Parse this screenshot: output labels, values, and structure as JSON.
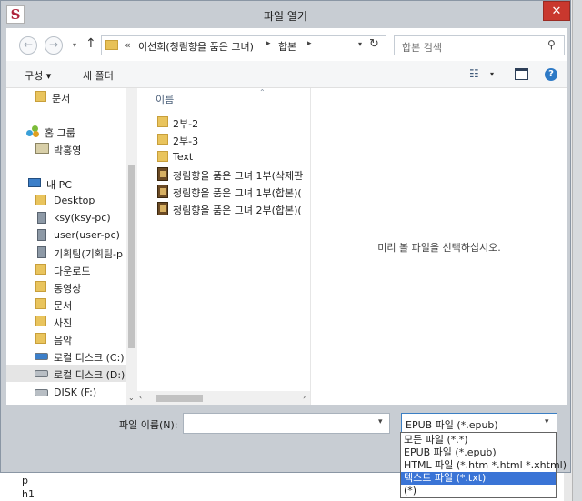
{
  "window": {
    "title": "파일 열기",
    "app_icon_glyph": "S",
    "close_glyph": "✕"
  },
  "nav": {
    "back_glyph": "←",
    "forward_glyph": "→",
    "dropdown_glyph": "▾",
    "up_glyph": "↑",
    "address": {
      "chevron": "«",
      "path1": "이선희(청림향을 품은 그녀)",
      "sep": "▸",
      "path2": "합본",
      "refresh_glyph": "↻"
    },
    "search": {
      "placeholder": "합본 검색",
      "icon_glyph": "⚲"
    }
  },
  "toolbar": {
    "organize_label": "구성 ▾",
    "new_folder_label": "새 폴더",
    "views_glyph": "☷",
    "help_glyph": "?"
  },
  "sidebar": {
    "items": [
      {
        "label": "문서",
        "icon": "folder-icon"
      },
      {
        "label": "홈 그룹",
        "icon": "homegroup-icon"
      },
      {
        "label": "박홍영",
        "icon": "user-icon"
      },
      {
        "label": "내 PC",
        "icon": "pc-icon"
      },
      {
        "label": "Desktop",
        "icon": "folder-icon"
      },
      {
        "label": "ksy(ksy-pc)",
        "icon": "network-icon"
      },
      {
        "label": "user(user-pc)",
        "icon": "network-icon"
      },
      {
        "label": "기획팀(기획팀-p",
        "icon": "network-icon"
      },
      {
        "label": "다운로드",
        "icon": "folder-icon"
      },
      {
        "label": "동영상",
        "icon": "folder-icon"
      },
      {
        "label": "문서",
        "icon": "folder-icon"
      },
      {
        "label": "사진",
        "icon": "folder-icon"
      },
      {
        "label": "음악",
        "icon": "folder-icon"
      },
      {
        "label": "로컬 디스크 (C:)",
        "icon": "drive-icon"
      },
      {
        "label": "로컬 디스크 (D:)",
        "icon": "drive-icon"
      },
      {
        "label": "DISK (F:)",
        "icon": "drive-icon"
      }
    ],
    "scroll_down_glyph": "⌄"
  },
  "filelist": {
    "column_name": "이름",
    "sort_glyph": "⌃",
    "items": [
      {
        "label": "2부-2",
        "icon": "folder-icon"
      },
      {
        "label": "2부-3",
        "icon": "folder-icon"
      },
      {
        "label": "Text",
        "icon": "folder-icon"
      },
      {
        "label": "청림향을 품은 그녀 1부(삭제판",
        "icon": "epub-icon"
      },
      {
        "label": "청림향을 품은 그녀 1부(합본)(",
        "icon": "epub-icon"
      },
      {
        "label": "청림향을 품은 그녀 2부(합본)(",
        "icon": "epub-icon"
      }
    ],
    "scroll_left_glyph": "‹",
    "scroll_right_glyph": "›"
  },
  "preview": {
    "message": "미리 볼 파일을 선택하십시오."
  },
  "bottom": {
    "filename_label": "파일 이름(N):",
    "filename_value": "",
    "filetype_selected": "EPUB 파일 (*.epub)",
    "filetype_options": [
      "모든 파일 (*.*)",
      "EPUB 파일 (*.epub)",
      "HTML 파일 (*.htm *.html *.xhtml)",
      "텍스트 파일 (*.txt)",
      "(*)"
    ],
    "highlighted_option_index": 3
  },
  "background_app": {
    "line1": "p",
    "line2": "h1"
  }
}
